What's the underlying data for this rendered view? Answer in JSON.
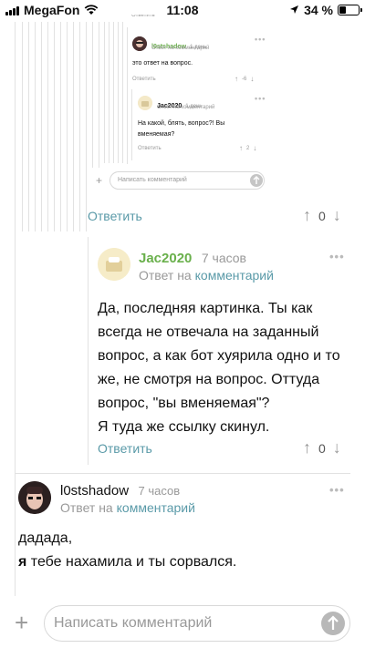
{
  "status_bar": {
    "carrier": "MegaFon",
    "time": "11:08",
    "battery": "34 %",
    "battery_level": 0.34
  },
  "nested": {
    "top_cut_reply": "Ответить",
    "comment1": {
      "author": "l0stshadow",
      "time": "1 день",
      "sub_prefix": "Ответ на",
      "sub_link": "комментарий",
      "text": "это ответ на вопрос.",
      "reply": "Ответить",
      "votes": "-6"
    },
    "comment2": {
      "author": "Jac2020",
      "time": "1 день",
      "sub_prefix": "Ответ на",
      "sub_link": "комментарий",
      "text_line1": "На какой, блять, вопрос?! Вы",
      "text_line2": "вменяемая?",
      "reply": "Ответить",
      "votes": "2"
    },
    "input_placeholder": "Написать комментарий"
  },
  "thread_reply": {
    "label": "Ответить",
    "votes": "0"
  },
  "jac_comment": {
    "author": "Jac2020",
    "time": "7 часов",
    "sub_prefix": "Ответ на",
    "sub_link": "комментарий",
    "lines": [
      "Да, последняя картинка. Ты как",
      "всегда не отвечала на заданный",
      "вопрос, а как бот хуярила одно и то",
      "же, не смотря на вопрос. Оттуда",
      "вопрос, \"вы вменяемая\"?",
      "Я туда же ссылку скинул."
    ],
    "reply": "Ответить",
    "votes": "0"
  },
  "lost_comment": {
    "author": "l0stshadow",
    "time": "7 часов",
    "sub_prefix": "Ответ на",
    "sub_link": "комментарий",
    "line1": "дадада,",
    "line2_bold": "я",
    "line2_rest": " тебе нахамила и ты сорвался."
  },
  "bottom_input": {
    "placeholder": "Написать комментарий"
  }
}
